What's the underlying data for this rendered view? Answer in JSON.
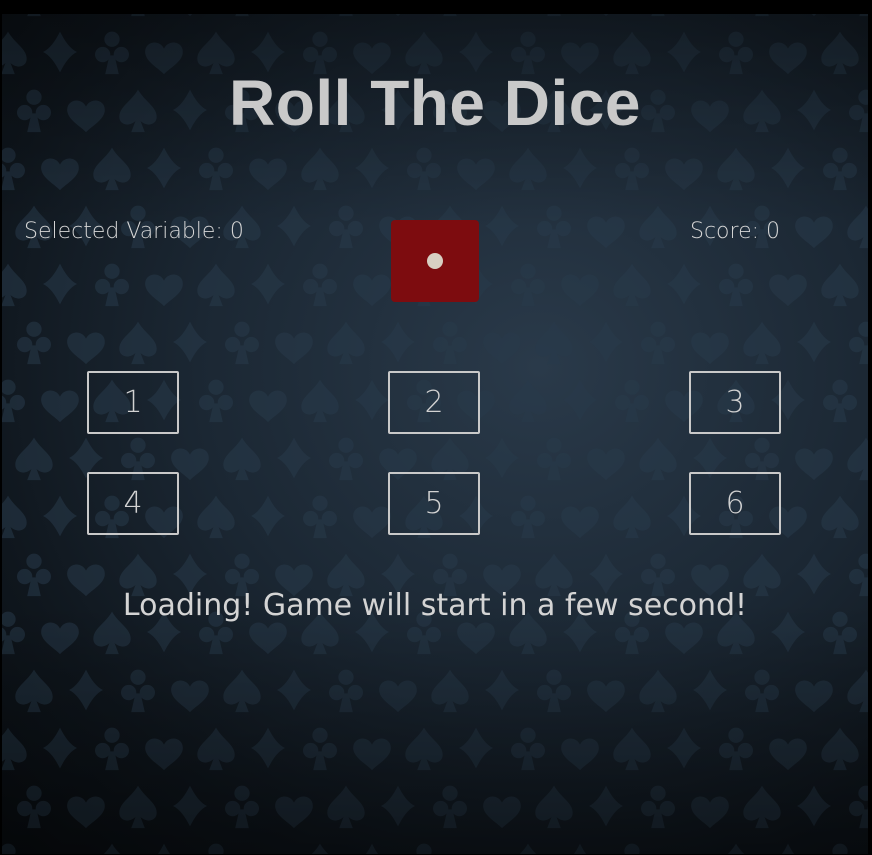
{
  "game": {
    "title": "Roll The Dice",
    "selected_variable": "Selected Variable: 0",
    "score": "Score: 0",
    "die": {
      "face_value": 1,
      "color": "#7d0c0f",
      "pip_color": "#d8cfc2"
    },
    "number_buttons": [
      "1",
      "2",
      "3",
      "4",
      "5",
      "6"
    ],
    "status_message": "Loading! Game will start in a few second!"
  },
  "background": {
    "pattern": "card-suits",
    "base_color": "#1b2733"
  }
}
